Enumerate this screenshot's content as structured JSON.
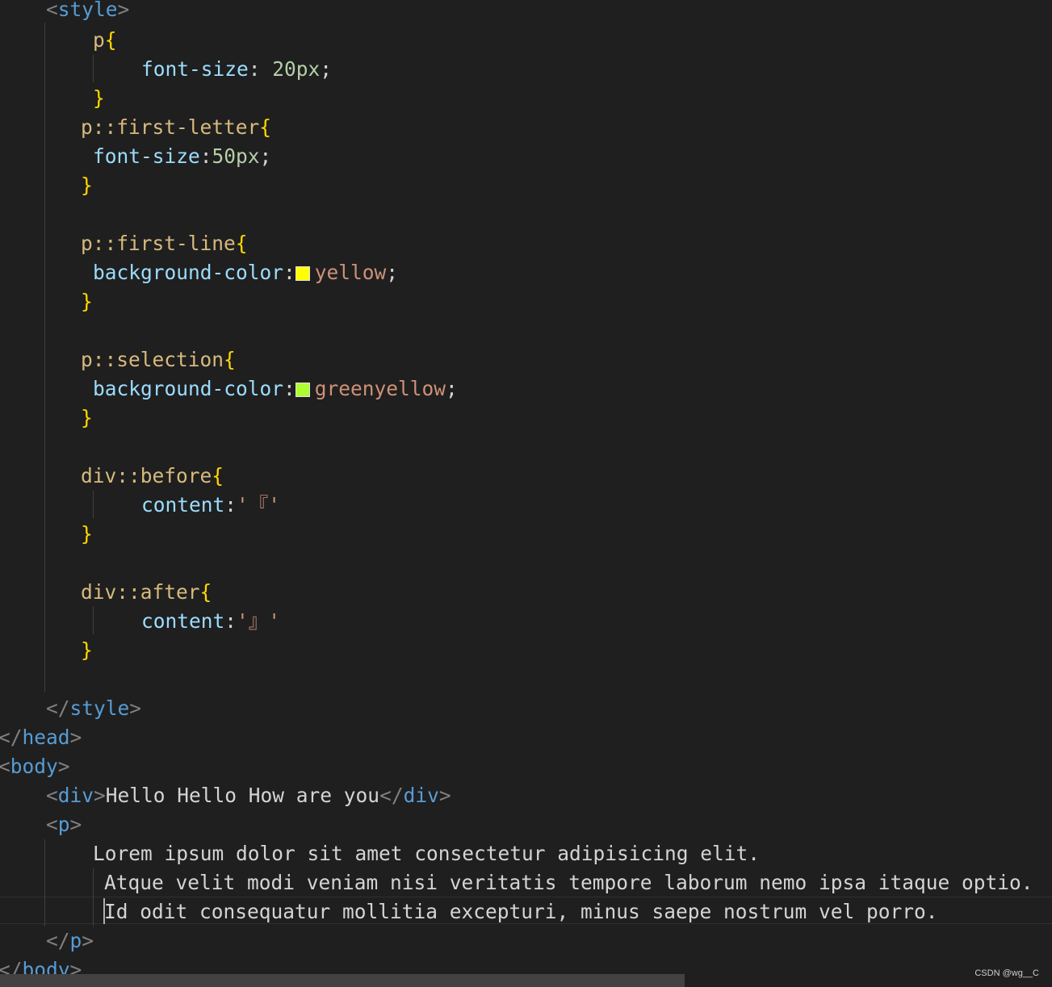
{
  "colors": {
    "background": "#1f1f1f",
    "tag_bracket": "#808080",
    "tag_name": "#569cd6",
    "selector": "#d7ba7d",
    "brace": "#ffd700",
    "property": "#9cdcfe",
    "number": "#b5cea8",
    "string": "#ce9178",
    "text": "#d4d4d4",
    "swatch_yellow": "#ffff00",
    "swatch_greenyellow": "#adff2f"
  },
  "code_lines": [
    {
      "tokens": [
        {
          "t": "<",
          "c": "tag_bracket"
        },
        {
          "t": "style",
          "c": "tag_name"
        },
        {
          "t": ">",
          "c": "tag_bracket"
        }
      ]
    },
    {
      "tokens": [
        {
          "t": "p",
          "c": "selector"
        },
        {
          "t": "{",
          "c": "brace"
        }
      ]
    },
    {
      "tokens": [
        {
          "t": "font-size",
          "c": "property"
        },
        {
          "t": ": ",
          "c": "text"
        },
        {
          "t": "20px",
          "c": "number"
        },
        {
          "t": ";",
          "c": "text"
        }
      ]
    },
    {
      "tokens": [
        {
          "t": "}",
          "c": "brace"
        }
      ]
    },
    {
      "tokens": [
        {
          "t": "p::first-letter",
          "c": "selector"
        },
        {
          "t": "{",
          "c": "brace"
        }
      ]
    },
    {
      "tokens": [
        {
          "t": "font-size",
          "c": "property"
        },
        {
          "t": ":",
          "c": "text"
        },
        {
          "t": "50px",
          "c": "number"
        },
        {
          "t": ";",
          "c": "text"
        }
      ]
    },
    {
      "tokens": [
        {
          "t": "}",
          "c": "brace"
        }
      ]
    },
    {
      "tokens": [
        {
          "t": "p::first-line",
          "c": "selector"
        },
        {
          "t": "{",
          "c": "brace"
        }
      ]
    },
    {
      "tokens": [
        {
          "t": "background-color",
          "c": "property"
        },
        {
          "t": ":",
          "c": "text"
        },
        {
          "swatch": "swatch_yellow"
        },
        {
          "t": "yellow",
          "c": "string"
        },
        {
          "t": ";",
          "c": "text"
        }
      ]
    },
    {
      "tokens": [
        {
          "t": "}",
          "c": "brace"
        }
      ]
    },
    {
      "tokens": [
        {
          "t": "p::selection",
          "c": "selector"
        },
        {
          "t": "{",
          "c": "brace"
        }
      ]
    },
    {
      "tokens": [
        {
          "t": "background-color",
          "c": "property"
        },
        {
          "t": ":",
          "c": "text"
        },
        {
          "swatch": "swatch_greenyellow"
        },
        {
          "t": "greenyellow",
          "c": "string"
        },
        {
          "t": ";",
          "c": "text"
        }
      ]
    },
    {
      "tokens": [
        {
          "t": "}",
          "c": "brace"
        }
      ]
    },
    {
      "tokens": [
        {
          "t": "div::before",
          "c": "selector"
        },
        {
          "t": "{",
          "c": "brace"
        }
      ]
    },
    {
      "tokens": [
        {
          "t": "content",
          "c": "property"
        },
        {
          "t": ":",
          "c": "text"
        },
        {
          "t": "'『'",
          "c": "string"
        }
      ]
    },
    {
      "tokens": [
        {
          "t": "}",
          "c": "brace"
        }
      ]
    },
    {
      "tokens": [
        {
          "t": "div::after",
          "c": "selector"
        },
        {
          "t": "{",
          "c": "brace"
        }
      ]
    },
    {
      "tokens": [
        {
          "t": "content",
          "c": "property"
        },
        {
          "t": ":",
          "c": "text"
        },
        {
          "t": "'』'",
          "c": "string"
        }
      ]
    },
    {
      "tokens": [
        {
          "t": "}",
          "c": "brace"
        }
      ]
    },
    {
      "tokens": [
        {
          "t": "</",
          "c": "tag_bracket"
        },
        {
          "t": "style",
          "c": "tag_name"
        },
        {
          "t": ">",
          "c": "tag_bracket"
        }
      ]
    },
    {
      "tokens": [
        {
          "t": "</",
          "c": "tag_bracket"
        },
        {
          "t": "head",
          "c": "tag_name"
        },
        {
          "t": ">",
          "c": "tag_bracket"
        }
      ]
    },
    {
      "tokens": [
        {
          "t": "<",
          "c": "tag_bracket"
        },
        {
          "t": "body",
          "c": "tag_name"
        },
        {
          "t": ">",
          "c": "tag_bracket"
        }
      ]
    },
    {
      "tokens": [
        {
          "t": "<",
          "c": "tag_bracket"
        },
        {
          "t": "div",
          "c": "tag_name"
        },
        {
          "t": ">",
          "c": "tag_bracket"
        },
        {
          "t": "Hello Hello How are you",
          "c": "text"
        },
        {
          "t": "</",
          "c": "tag_bracket"
        },
        {
          "t": "div",
          "c": "tag_name"
        },
        {
          "t": ">",
          "c": "tag_bracket"
        }
      ]
    },
    {
      "tokens": [
        {
          "t": "<",
          "c": "tag_bracket"
        },
        {
          "t": "p",
          "c": "tag_name"
        },
        {
          "t": ">",
          "c": "tag_bracket"
        }
      ]
    },
    {
      "tokens": [
        {
          "t": "Lorem ipsum dolor sit amet consectetur adipisicing elit.",
          "c": "text"
        }
      ]
    },
    {
      "tokens": [
        {
          "t": "Atque velit modi veniam nisi veritatis tempore laborum nemo ipsa itaque optio.",
          "c": "text"
        }
      ]
    },
    {
      "tokens": [
        {
          "t": "Id odit consequatur mollitia excepturi, minus saepe nostrum vel porro.",
          "c": "text"
        }
      ]
    },
    {
      "tokens": [
        {
          "t": "</",
          "c": "tag_bracket"
        },
        {
          "t": "p",
          "c": "tag_name"
        },
        {
          "t": ">",
          "c": "tag_bracket"
        }
      ]
    },
    {
      "tokens": [
        {
          "t": "</",
          "c": "tag_bracket"
        },
        {
          "t": "body",
          "c": "tag_name"
        },
        {
          "t": ">",
          "c": "tag_bracket"
        }
      ]
    }
  ],
  "watermark": "CSDN @wg__C"
}
